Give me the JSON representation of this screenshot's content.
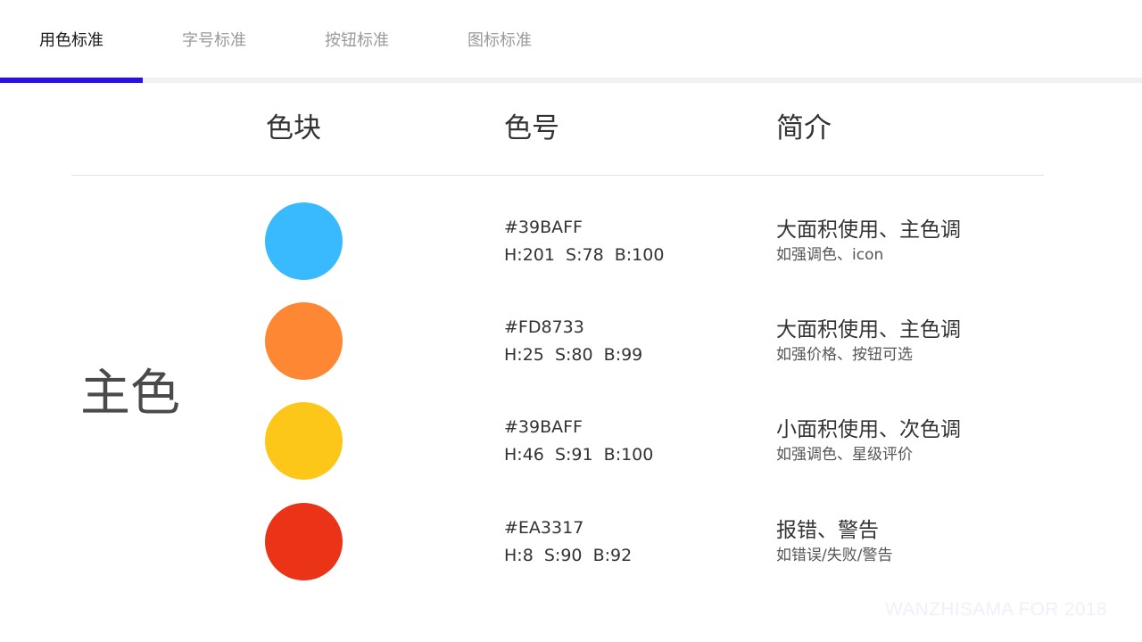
{
  "tabs": [
    {
      "label": "用色标准",
      "active": true
    },
    {
      "label": "字号标准",
      "active": false
    },
    {
      "label": "按钮标准",
      "active": false
    },
    {
      "label": "图标标准",
      "active": false
    }
  ],
  "colors": {
    "accent": "#2a10ea",
    "tab_track": "#f1f1f3"
  },
  "table": {
    "headers": {
      "swatch": "色块",
      "code": "色号",
      "desc": "简介"
    },
    "section_label": "主色",
    "rows": [
      {
        "color": "#39BAFF",
        "hex": "#39BAFF",
        "hsb": "H:201  S:78  B:100",
        "title": "大面积使用、主色调",
        "sub": "如强调色、icon"
      },
      {
        "color": "#FD8733",
        "hex": "#FD8733",
        "hsb": "H:25  S:80  B:99",
        "title": "大面积使用、主色调",
        "sub": "如强价格、按钮可选"
      },
      {
        "color": "#FDC71A",
        "hex": "#39BAFF",
        "hsb": "H:46  S:91  B:100",
        "title": "小面积使用、次色调",
        "sub": "如强调色、星级评价"
      },
      {
        "color": "#EA3317",
        "hex": "#EA3317",
        "hsb": "H:8  S:90  B:92",
        "title": "报错、警告",
        "sub": "如错误/失败/警告"
      }
    ]
  },
  "watermark": "WANZHISAMA FOR 2018"
}
